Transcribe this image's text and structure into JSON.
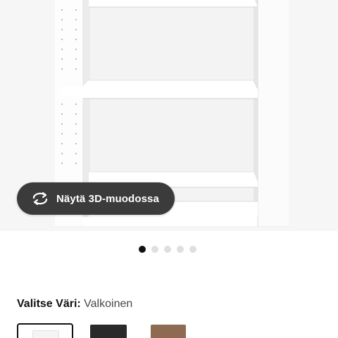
{
  "product_image": {
    "alt": "",
    "view_3d_label": "Näytä 3D-muodossa"
  },
  "carousel": {
    "count": 5,
    "active_index": 0
  },
  "color_picker": {
    "heading_key": "Valitse Väri:",
    "selected_value": "Valkoinen",
    "swatches": [
      {
        "name": "white",
        "color": "#f4f4f2",
        "selected": true
      },
      {
        "name": "black-brown",
        "color": "#2b2a2a",
        "selected": false
      },
      {
        "name": "brown-walnut",
        "color": "#8e6a52",
        "selected": false
      }
    ]
  }
}
